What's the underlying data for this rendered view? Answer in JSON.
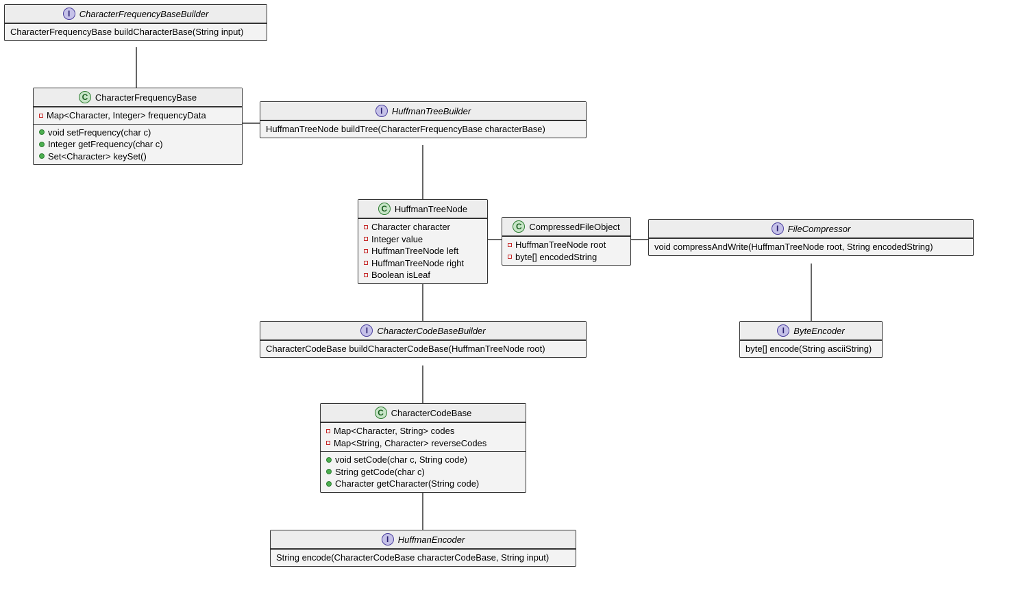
{
  "classes": {
    "cfbb": {
      "type": "I",
      "name": "CharacterFrequencyBaseBuilder",
      "members": [
        {
          "text": "CharacterFrequencyBase buildCharacterBase(String input)"
        }
      ]
    },
    "cfb": {
      "type": "C",
      "name": "CharacterFrequencyBase",
      "fields": [
        {
          "viz": "private",
          "text": "Map<Character, Integer> frequencyData"
        }
      ],
      "methods": [
        {
          "viz": "public",
          "text": "void setFrequency(char c)"
        },
        {
          "viz": "public",
          "text": "Integer getFrequency(char c)"
        },
        {
          "viz": "public",
          "text": "Set<Character> keySet()"
        }
      ]
    },
    "htb": {
      "type": "I",
      "name": "HuffmanTreeBuilder",
      "members": [
        {
          "text": "HuffmanTreeNode buildTree(CharacterFrequencyBase characterBase)"
        }
      ]
    },
    "htn": {
      "type": "C",
      "name": "HuffmanTreeNode",
      "fields": [
        {
          "viz": "private",
          "text": "Character character"
        },
        {
          "viz": "private",
          "text": "Integer value"
        },
        {
          "viz": "private",
          "text": "HuffmanTreeNode left"
        },
        {
          "viz": "private",
          "text": "HuffmanTreeNode right"
        },
        {
          "viz": "private",
          "text": "Boolean isLeaf"
        }
      ]
    },
    "cfo": {
      "type": "C",
      "name": "CompressedFileObject",
      "fields": [
        {
          "viz": "private",
          "text": "HuffmanTreeNode root"
        },
        {
          "viz": "private",
          "text": "byte[] encodedString"
        }
      ]
    },
    "fc": {
      "type": "I",
      "name": "FileCompressor",
      "members": [
        {
          "text": "void compressAndWrite(HuffmanTreeNode root, String encodedString)"
        }
      ]
    },
    "ccbb": {
      "type": "I",
      "name": "CharacterCodeBaseBuilder",
      "members": [
        {
          "text": "CharacterCodeBase buildCharacterCodeBase(HuffmanTreeNode root)"
        }
      ]
    },
    "be": {
      "type": "I",
      "name": "ByteEncoder",
      "members": [
        {
          "text": "byte[] encode(String asciiString)"
        }
      ]
    },
    "ccb": {
      "type": "C",
      "name": "CharacterCodeBase",
      "fields": [
        {
          "viz": "private",
          "text": "Map<Character, String> codes"
        },
        {
          "viz": "private",
          "text": "Map<String, Character> reverseCodes"
        }
      ],
      "methods": [
        {
          "viz": "public",
          "text": "void setCode(char c, String code)"
        },
        {
          "viz": "public",
          "text": "String getCode(char c)"
        },
        {
          "viz": "public",
          "text": "Character getCharacter(String code)"
        }
      ]
    },
    "he": {
      "type": "I",
      "name": "HuffmanEncoder",
      "members": [
        {
          "text": "String encode(CharacterCodeBase characterCodeBase, String input)"
        }
      ]
    }
  }
}
